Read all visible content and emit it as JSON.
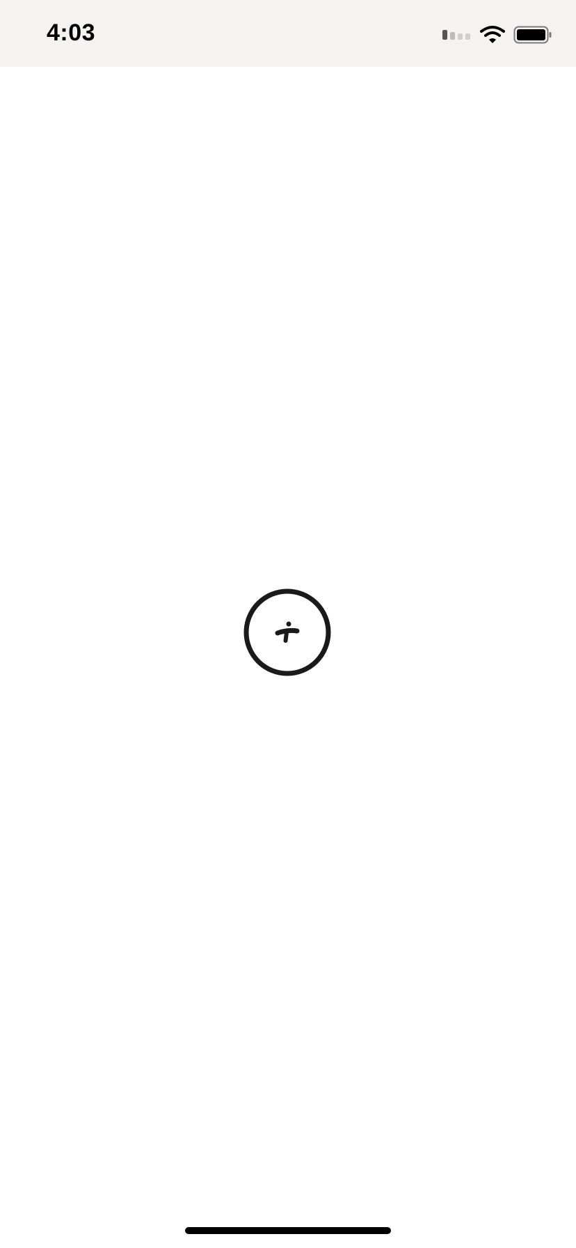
{
  "status_bar": {
    "time": "4:03",
    "icons": [
      "signal-icon",
      "wifi-icon",
      "battery-icon"
    ],
    "background": "#f4f3ef"
  },
  "main": {
    "loader_icon": "circle-logo-icon",
    "background": "#ffffff",
    "icon_color": "#1a1a1a"
  },
  "home_indicator": {
    "color": "#000000"
  }
}
